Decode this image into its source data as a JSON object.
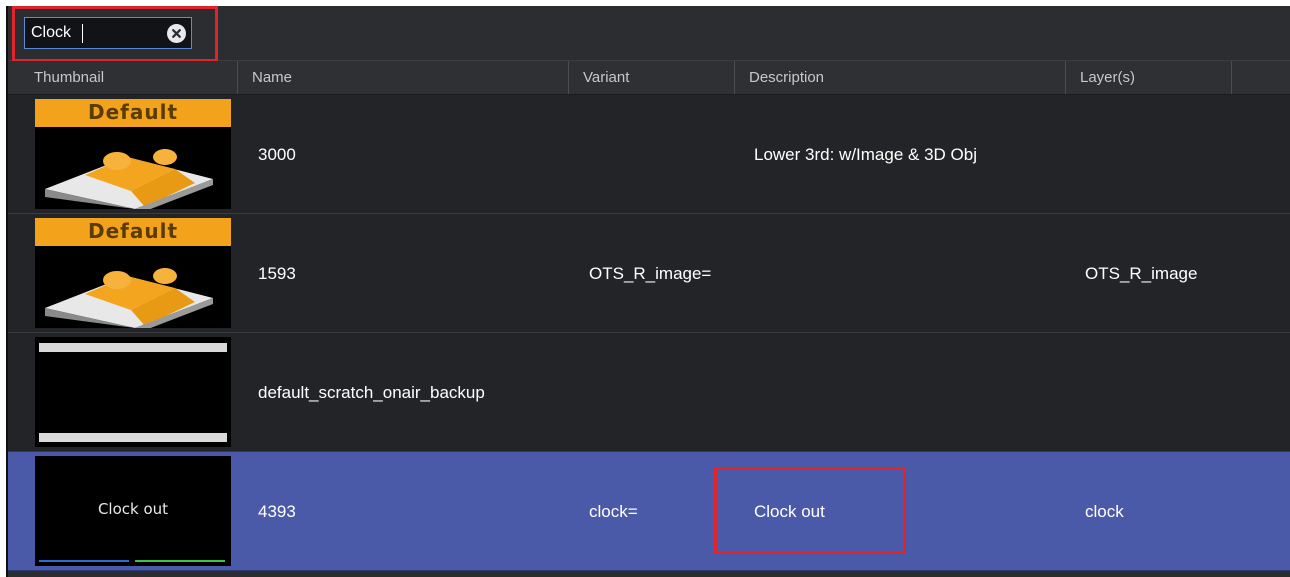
{
  "search": {
    "value": "Clock",
    "clear_icon": "close-circle-icon"
  },
  "columns": [
    "Thumbnail",
    "Name",
    "Variant",
    "Description",
    "Layer(s)"
  ],
  "rows": [
    {
      "thumbnail": {
        "type": "default",
        "banner": "Default"
      },
      "name": "3000",
      "variant": "",
      "description": "Lower 3rd: w/Image & 3D Obj",
      "layers": "",
      "selected": false
    },
    {
      "thumbnail": {
        "type": "default",
        "banner": "Default"
      },
      "name": "1593",
      "variant": "OTS_R_image=",
      "description": "",
      "layers": "OTS_R_image",
      "selected": false
    },
    {
      "thumbnail": {
        "type": "scratch"
      },
      "name": "default_scratch_onair_backup",
      "variant": "",
      "description": "",
      "layers": "",
      "selected": false
    },
    {
      "thumbnail": {
        "type": "clockout",
        "text": "Clock out"
      },
      "name": "4393",
      "variant": "clock=",
      "description": "Clock out",
      "layers": "clock",
      "selected": true
    }
  ],
  "colors": {
    "background": "#242629",
    "selected_row": "#4b5aa8",
    "highlight": "#e0242a",
    "search_border": "#5b8bd6"
  }
}
